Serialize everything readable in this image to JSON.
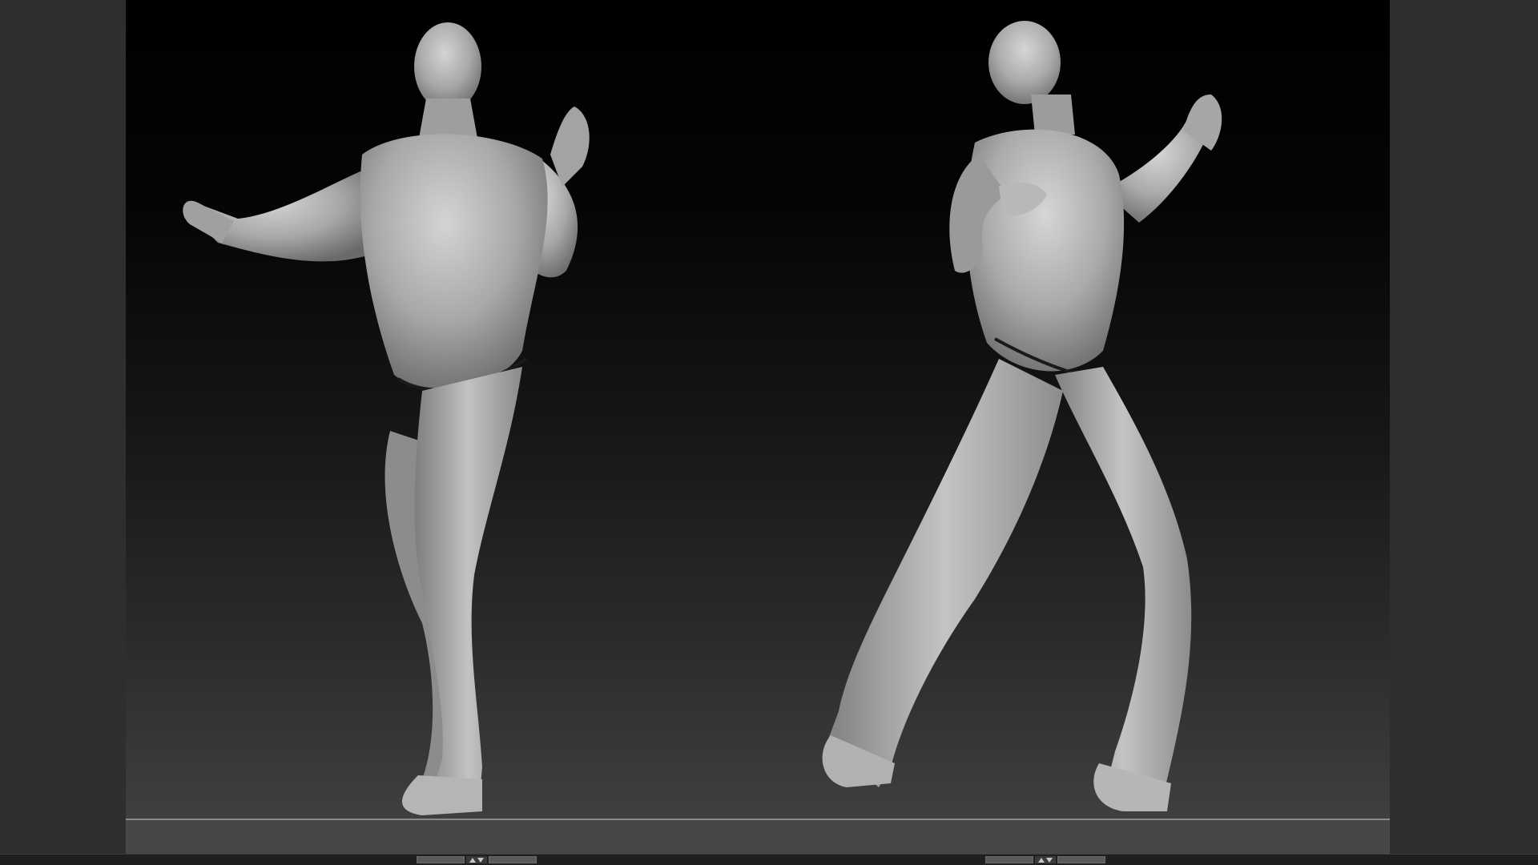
{
  "app": {
    "type": "3d-sculpt-viewport"
  },
  "viewport": {
    "background_top": "#000000",
    "background_bottom": "#434343",
    "floor_line_color": "#8a8a8a",
    "model_color": "#b3b3b3"
  },
  "figures": [
    {
      "name": "figure-front-view",
      "icon": "male-sculpt-front"
    },
    {
      "name": "figure-side-view",
      "icon": "male-sculpt-side"
    }
  ],
  "controls": {
    "left_stepper_icon": "up-down-arrows",
    "right_stepper_icon": "up-down-arrows"
  }
}
